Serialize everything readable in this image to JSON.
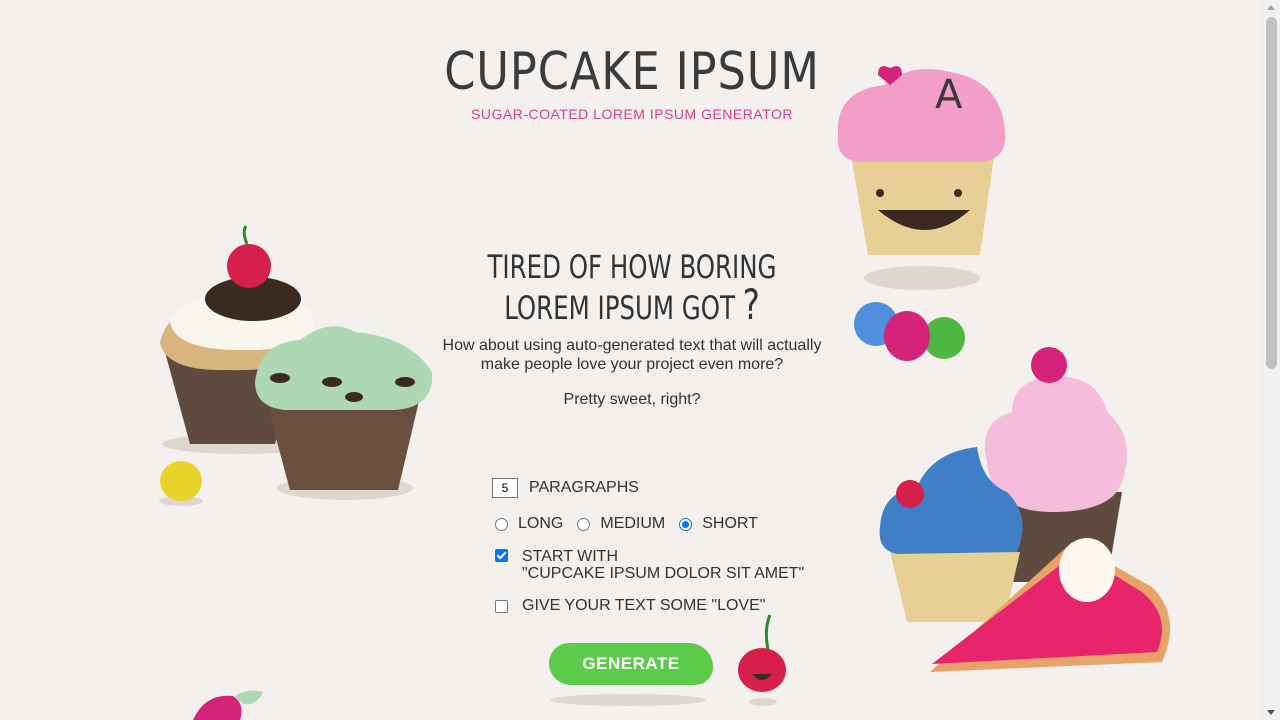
{
  "header": {
    "title": "CUPCAKE IPSUM",
    "subtitle": "SUGAR-COATED LOREM IPSUM GENERATOR"
  },
  "hero": {
    "headline_line1": "TIRED OF HOW BORING",
    "headline_line2": "LOREM IPSUM GOT",
    "headline_mark": "?",
    "intro_line1": "How about using auto-generated text that will actually",
    "intro_line2": "make people love your project even more?",
    "tagline": "Pretty sweet, right?"
  },
  "form": {
    "paragraphs_value": "5",
    "paragraphs_label": "PARAGRAPHS",
    "length_options": [
      {
        "label": "LONG",
        "selected": false
      },
      {
        "label": "MEDIUM",
        "selected": false
      },
      {
        "label": "SHORT",
        "selected": true
      }
    ],
    "start_with_checked": true,
    "start_with_line1": "START WITH",
    "start_with_line2": "\"CUPCAKE IPSUM DOLOR SIT AMET\"",
    "love_checked": false,
    "love_label": "GIVE YOUR TEXT SOME \"LOVE\"",
    "generate_label": "GENERATE"
  },
  "illustration": {
    "cupcake_letter": "A"
  },
  "colors": {
    "background": "#f3f0ee",
    "accent_pink": "#d9418f",
    "button_green": "#5ccb4a",
    "checkbox_blue": "#0075ff"
  }
}
